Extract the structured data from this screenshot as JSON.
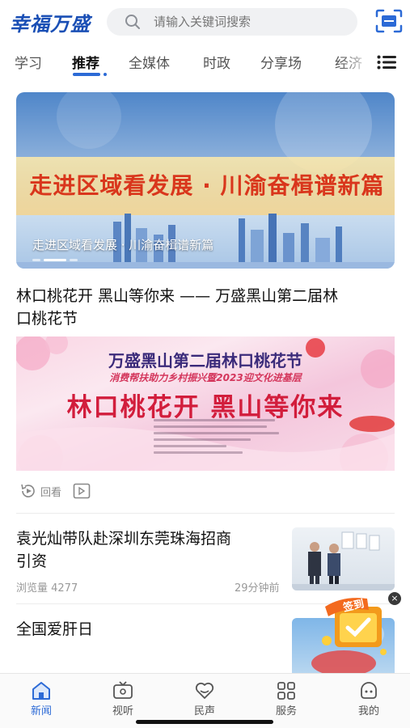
{
  "header": {
    "logo_text": "幸福万盛",
    "search_placeholder": "请输入关键词搜索",
    "scan_icon": "scan-icon"
  },
  "tabs": [
    {
      "label": "学习",
      "active": false
    },
    {
      "label": "推荐",
      "active": true
    },
    {
      "label": "全媒体",
      "active": false
    },
    {
      "label": "时政",
      "active": false
    },
    {
      "label": "分享场",
      "active": false
    },
    {
      "label": "经济",
      "active": false
    }
  ],
  "banner": {
    "headline": "走进区域看发展 · 川渝奋楫谱新篇",
    "caption": "走进区域看发展 · 川渝奋楫谱新篇"
  },
  "articles": {
    "first": {
      "title_line1": "林口桃花开 黑山等你来 —— 万盛黑山第二届林",
      "title_line2": "口桃花节",
      "poster_top": "万盛黑山第二届林口桃花节",
      "poster_sub": "消费帮扶助力乡村振兴暨2023迎文化进基层",
      "poster_main": "林口桃花开  黑山等你来",
      "replay_label": "回看"
    },
    "second": {
      "title_line1": "袁光灿带队赴深圳东莞珠海招商",
      "title_line2": "引资",
      "views": "浏览量 4277",
      "time": "29分钟前"
    },
    "third": {
      "title": "全国爱肝日"
    }
  },
  "floating": {
    "signin_label": "签到",
    "close_label": "×"
  },
  "bottom_nav": [
    {
      "label": "新闻",
      "icon": "home-icon",
      "active": true
    },
    {
      "label": "视听",
      "icon": "tv-icon",
      "active": false
    },
    {
      "label": "民声",
      "icon": "heart-icon",
      "active": false
    },
    {
      "label": "服务",
      "icon": "grid-icon",
      "active": false
    },
    {
      "label": "我的",
      "icon": "profile-icon",
      "active": false
    }
  ],
  "colors": {
    "accent": "#2c6ad6",
    "logo": "#1a4fb5",
    "headline_red": "#d9361c"
  }
}
